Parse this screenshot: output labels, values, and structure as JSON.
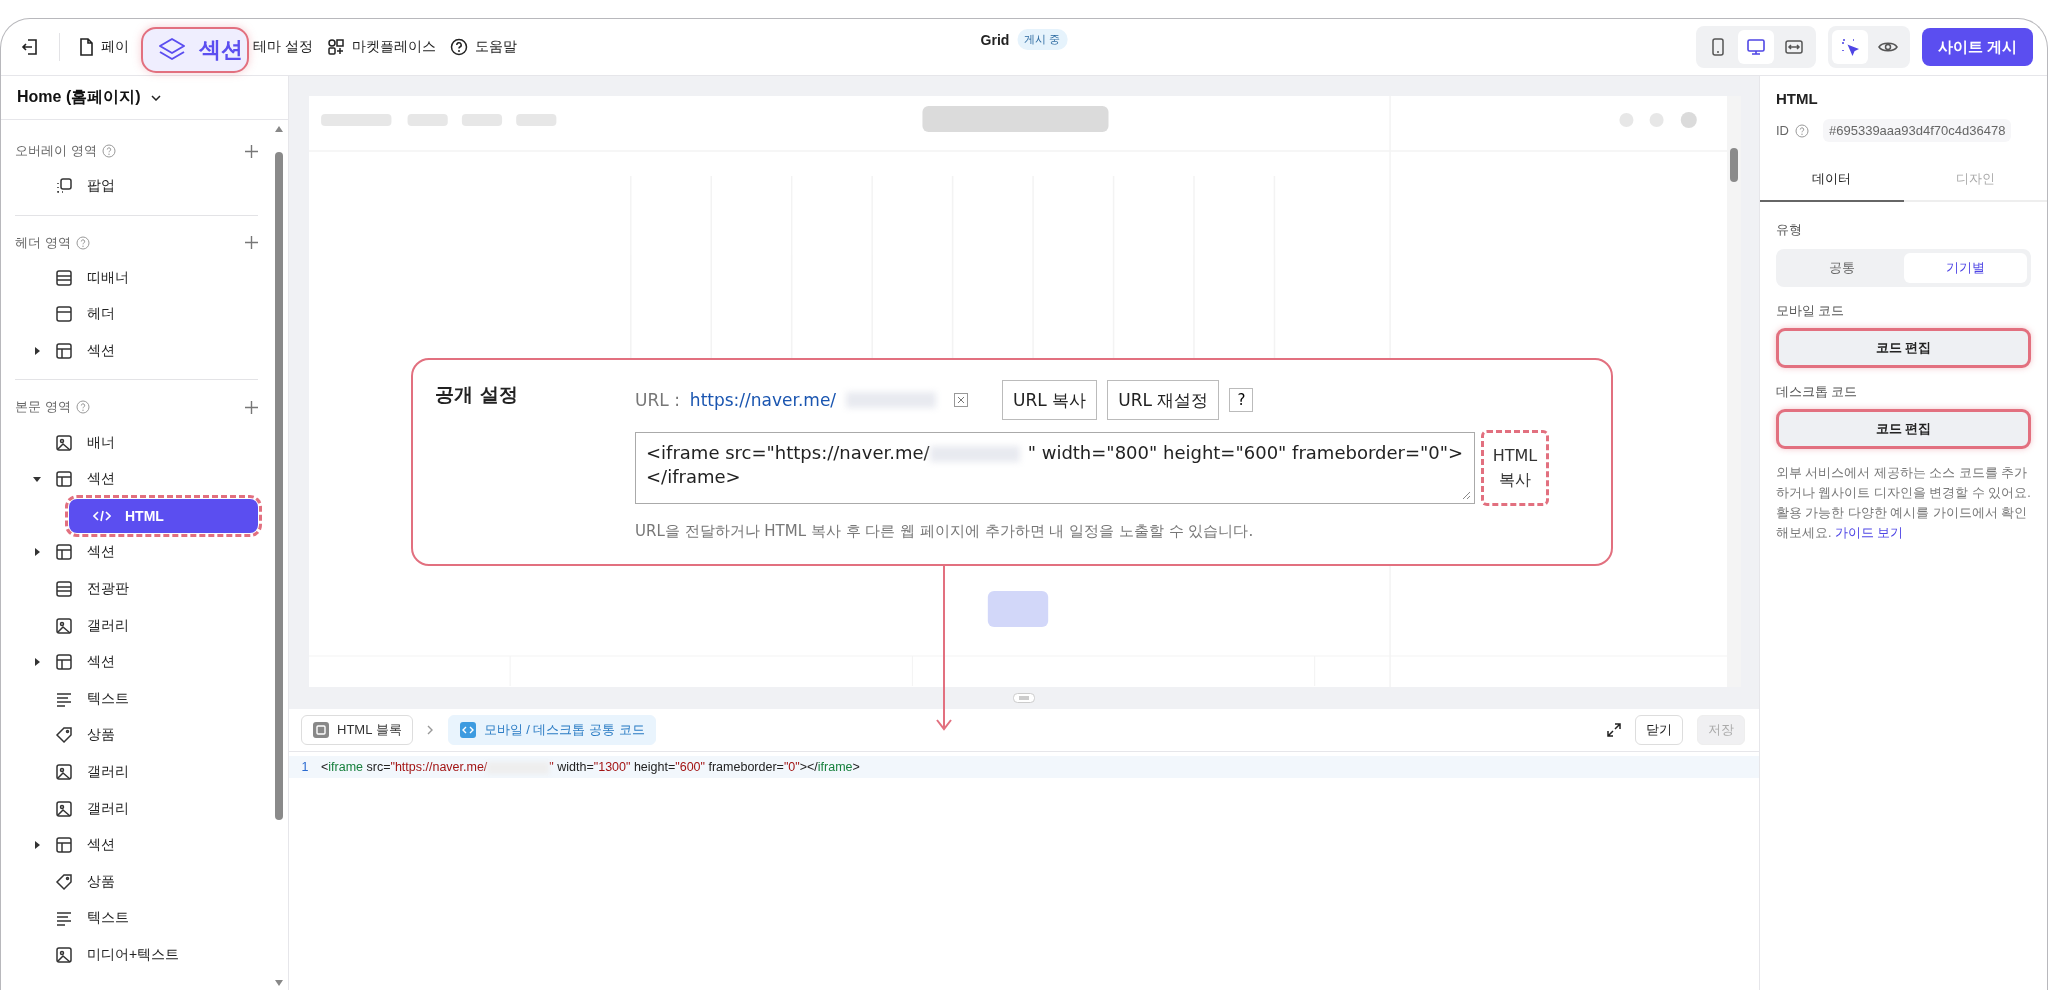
{
  "topbar": {
    "menu": [
      {
        "label": "페이",
        "kind": "page"
      },
      {
        "label": "테마 설정",
        "kind": "plain"
      },
      {
        "label": "마켓플레이스",
        "kind": "market"
      },
      {
        "label": "도움말",
        "kind": "help"
      }
    ],
    "callout": {
      "label": "섹션"
    },
    "title": "Grid",
    "status": "게시 중",
    "devices": [
      {
        "kind": "mobile",
        "selected": false
      },
      {
        "kind": "desktop",
        "selected": true
      },
      {
        "kind": "responsive",
        "selected": false
      }
    ],
    "tools": [
      {
        "kind": "select",
        "selected": true
      },
      {
        "kind": "preview",
        "selected": false
      }
    ],
    "publish_button": "사이트 게시"
  },
  "sidebar": {
    "page_selector": "Home (홈페이지)",
    "groups": [
      {
        "title": "오버레이 영역",
        "items": [
          {
            "label": "팝업",
            "kind": "popup",
            "selected": false
          }
        ]
      },
      {
        "title": "헤더 영역",
        "items": [
          {
            "label": "띠배너",
            "kind": "strip",
            "selected": false
          },
          {
            "label": "헤더",
            "kind": "header",
            "selected": false
          },
          {
            "label": "섹션",
            "kind": "section",
            "selected": false,
            "expanded": false
          }
        ]
      },
      {
        "title": "본문 영역",
        "items": [
          {
            "label": "배너",
            "kind": "image",
            "selected": false
          },
          {
            "label": "섹션",
            "kind": "section",
            "selected": false,
            "expanded": true,
            "children": [
              {
                "label": "HTML",
                "kind": "code",
                "selected": true,
                "highlighted": true
              }
            ]
          },
          {
            "label": "섹션",
            "kind": "section",
            "selected": false,
            "expanded": false
          },
          {
            "label": "전광판",
            "kind": "strip",
            "selected": false
          },
          {
            "label": "갤러리",
            "kind": "image",
            "selected": false
          },
          {
            "label": "섹션",
            "kind": "section",
            "selected": false,
            "expanded": false
          },
          {
            "label": "텍스트",
            "kind": "text",
            "selected": false
          },
          {
            "label": "상품",
            "kind": "tag",
            "selected": false
          },
          {
            "label": "갤러리",
            "kind": "image",
            "selected": false
          },
          {
            "label": "갤러리",
            "kind": "image",
            "selected": false
          },
          {
            "label": "섹션",
            "kind": "section",
            "selected": false,
            "expanded": false
          },
          {
            "label": "상품",
            "kind": "tag",
            "selected": false
          },
          {
            "label": "텍스트",
            "kind": "text",
            "selected": false
          },
          {
            "label": "미디어+텍스트",
            "kind": "image",
            "selected": false
          }
        ]
      }
    ]
  },
  "popup": {
    "title": "공개 설정",
    "url_label": "URL :",
    "url": "https://naver.me/",
    "buttons": [
      "URL 복사",
      "URL 재설정",
      "?"
    ],
    "code": [
      {
        "text": "<iframe src=\"https://naver.me/",
        "kind": "text"
      },
      {
        "kind": "redacted"
      },
      {
        "text": "\" width=\"800\" height=\"600\" frameborder=\"0\"></iframe>",
        "kind": "text"
      }
    ],
    "copy_button": {
      "label": "HTML 복사",
      "highlighted": true
    },
    "notice": "URL을 전달하거나 HTML 복사 후 다른 웹 페이지에 추가하면 내 일정을 노출할 수 있습니다."
  },
  "editor": {
    "breadcrumb": [
      {
        "label": "HTML 블록",
        "kind": "block"
      },
      {
        "label": "모바일 / 데스크톱 공통 코드",
        "kind": "code"
      }
    ],
    "buttons": [
      {
        "label": "닫기",
        "disabled": false
      },
      {
        "label": "저장",
        "disabled": true
      }
    ],
    "lines": [
      {
        "number": "1",
        "tokens": [
          {
            "kind": "punct",
            "text": "<"
          },
          {
            "kind": "tag",
            "text": "iframe"
          },
          {
            "kind": "attr",
            "text": " src="
          },
          {
            "kind": "string",
            "text": "\"https://naver.me/"
          },
          {
            "kind": "redacted"
          },
          {
            "kind": "string",
            "text": "\""
          },
          {
            "kind": "attr",
            "text": " width="
          },
          {
            "kind": "string",
            "text": "\"1300\""
          },
          {
            "kind": "attr",
            "text": " height="
          },
          {
            "kind": "string",
            "text": "\"600\""
          },
          {
            "kind": "attr",
            "text": " frameborder="
          },
          {
            "kind": "string",
            "text": "\"0\""
          },
          {
            "kind": "punct",
            "text": "></"
          },
          {
            "kind": "tag",
            "text": "iframe"
          },
          {
            "kind": "punct",
            "text": ">"
          }
        ]
      }
    ]
  },
  "inspector": {
    "title": "HTML",
    "id_label": "ID",
    "id_value": "#695339aaa93d4f70c4d36478",
    "tabs": [
      {
        "label": "데이터",
        "selected": true
      },
      {
        "label": "디자인",
        "selected": false
      }
    ],
    "type_label": "유형",
    "type_options": [
      {
        "label": "공통",
        "selected": false
      },
      {
        "label": "기기별",
        "selected": true
      }
    ],
    "fields": [
      {
        "label": "모바일 코드",
        "button": "코드 편집",
        "highlighted": true
      },
      {
        "label": "데스크톱 코드",
        "button": "코드 편집",
        "highlighted": true
      }
    ],
    "help": "외부 서비스에서 제공하는 소스 코드를 추가하거나 웹사이트 디자인을 변경할 수 있어요. 활용 가능한 다양한 예시를 가이드에서 확인해보세요.",
    "help_link": "가이드 보기"
  }
}
